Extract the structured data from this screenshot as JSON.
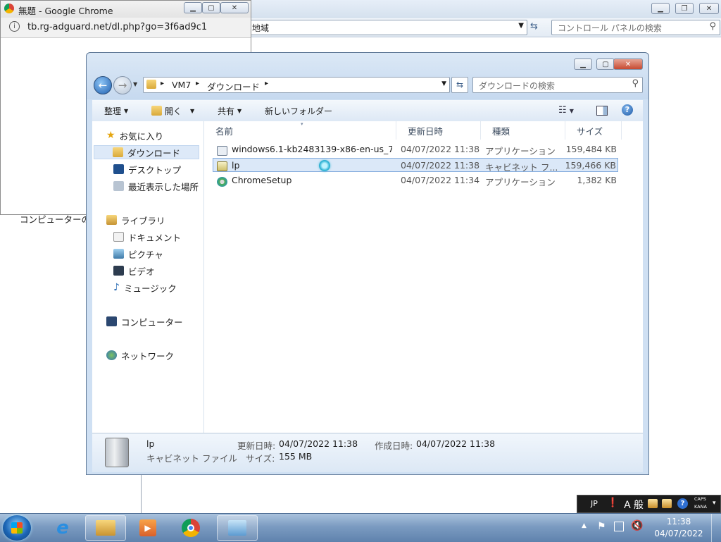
{
  "control_panel": {
    "address_fragment": "地域",
    "search_placeholder": "コントロール パネルの検索",
    "behind_text": "コンピューターの"
  },
  "chrome": {
    "title": "無題 - Google Chrome",
    "url": "tb.rg-adguard.net/dl.php?go=3f6ad9c1"
  },
  "explorer": {
    "breadcrumb": [
      "VM7",
      "ダウンロード"
    ],
    "search_placeholder": "ダウンロードの検索",
    "toolbar": {
      "organize": "整理",
      "open": "開く",
      "share": "共有",
      "new_folder": "新しいフォルダー"
    },
    "nav": {
      "favorites": "お気に入り",
      "downloads": "ダウンロード",
      "desktop": "デスクトップ",
      "recent": "最近表示した場所",
      "libraries": "ライブラリ",
      "documents": "ドキュメント",
      "pictures": "ピクチャ",
      "videos": "ビデオ",
      "music": "ミュージック",
      "computer": "コンピューター",
      "network": "ネットワーク"
    },
    "columns": {
      "name": "名前",
      "modified": "更新日時",
      "type": "種類",
      "size": "サイズ"
    },
    "files": [
      {
        "name": "windows6.1-kb2483139-x86-en-us_7...",
        "modified": "04/07/2022 11:38",
        "type": "アプリケーション",
        "size": "159,484 KB"
      },
      {
        "name": "lp",
        "modified": "04/07/2022 11:38",
        "type": "キャビネット フ...",
        "size": "159,466 KB"
      },
      {
        "name": "ChromeSetup",
        "modified": "04/07/2022 11:34",
        "type": "アプリケーション",
        "size": "1,382 KB"
      }
    ],
    "details": {
      "name": "lp",
      "type": "キャビネット ファイル",
      "modified_label": "更新日時:",
      "modified": "04/07/2022 11:38",
      "created_label": "作成日時:",
      "created": "04/07/2022 11:38",
      "size_label": "サイズ:",
      "size": "155 MB"
    }
  },
  "ime": {
    "lang": "JP",
    "mode": "般",
    "caps": "CAPS",
    "kana": "KANA"
  },
  "clock": {
    "time": "11:38",
    "date": "04/07/2022"
  }
}
